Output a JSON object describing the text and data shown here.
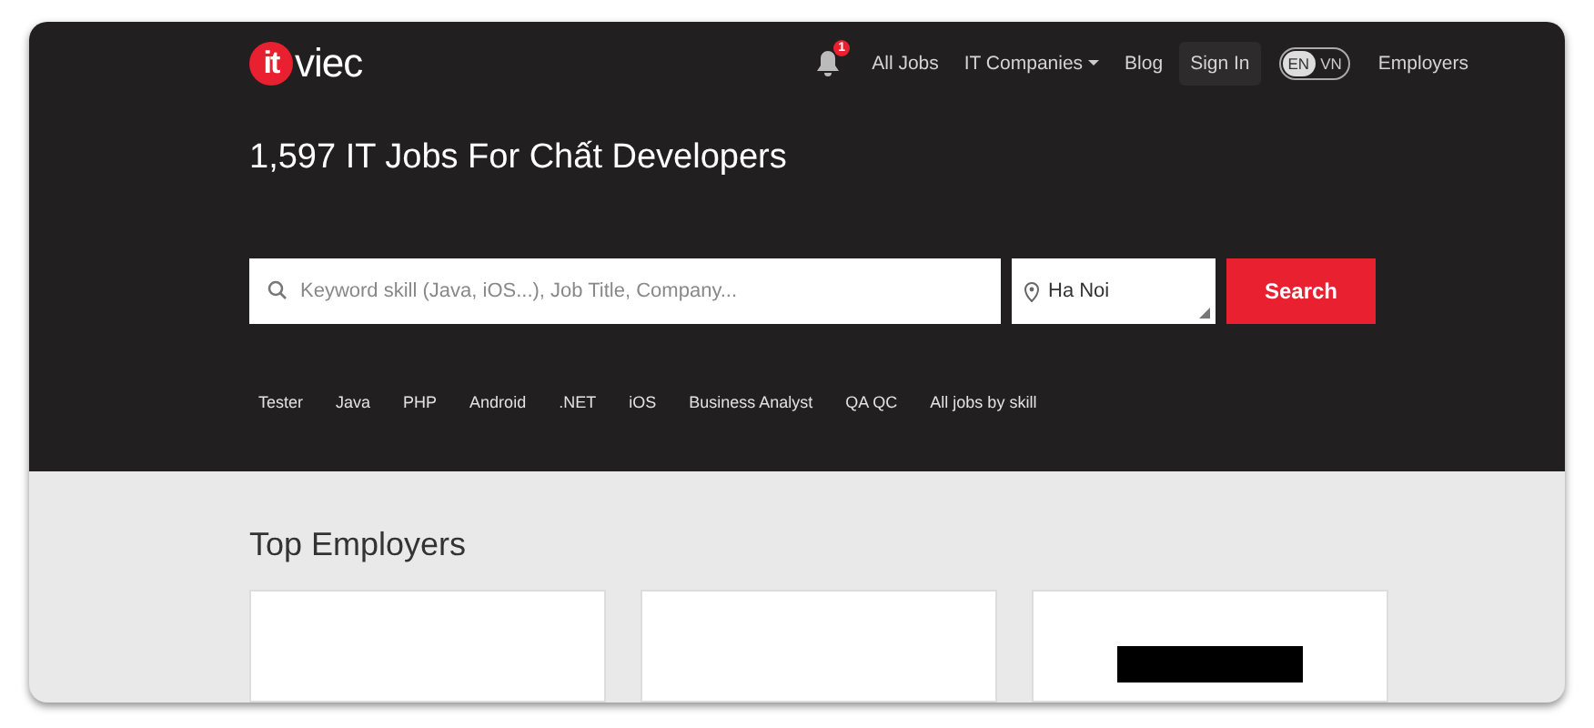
{
  "logo": {
    "mark": "it",
    "word": "viec"
  },
  "notifications": {
    "count": "1"
  },
  "nav": [
    {
      "label": "All Jobs",
      "kind": "link"
    },
    {
      "label": "IT Companies",
      "kind": "dropdown"
    },
    {
      "label": "Blog",
      "kind": "link"
    },
    {
      "label": "Sign In",
      "kind": "boxed"
    }
  ],
  "language": [
    {
      "label": "EN",
      "selected": true
    },
    {
      "label": "VN",
      "selected": false
    }
  ],
  "employers_link": "Employers",
  "headline": "1,597 IT Jobs For Chất Developers",
  "search": {
    "placeholder": "Keyword skill (Java, iOS...), Job Title, Company...",
    "location": "Ha Noi",
    "button": "Search"
  },
  "skills": [
    "Tester",
    "Java",
    "PHP",
    "Android",
    ".NET",
    "iOS",
    "Business Analyst",
    "QA QC",
    "All jobs by skill"
  ],
  "top_employers": {
    "title": "Top Employers",
    "cards": [
      {
        "kind": "blank"
      },
      {
        "kind": "blank"
      },
      {
        "kind": "logo"
      }
    ]
  }
}
